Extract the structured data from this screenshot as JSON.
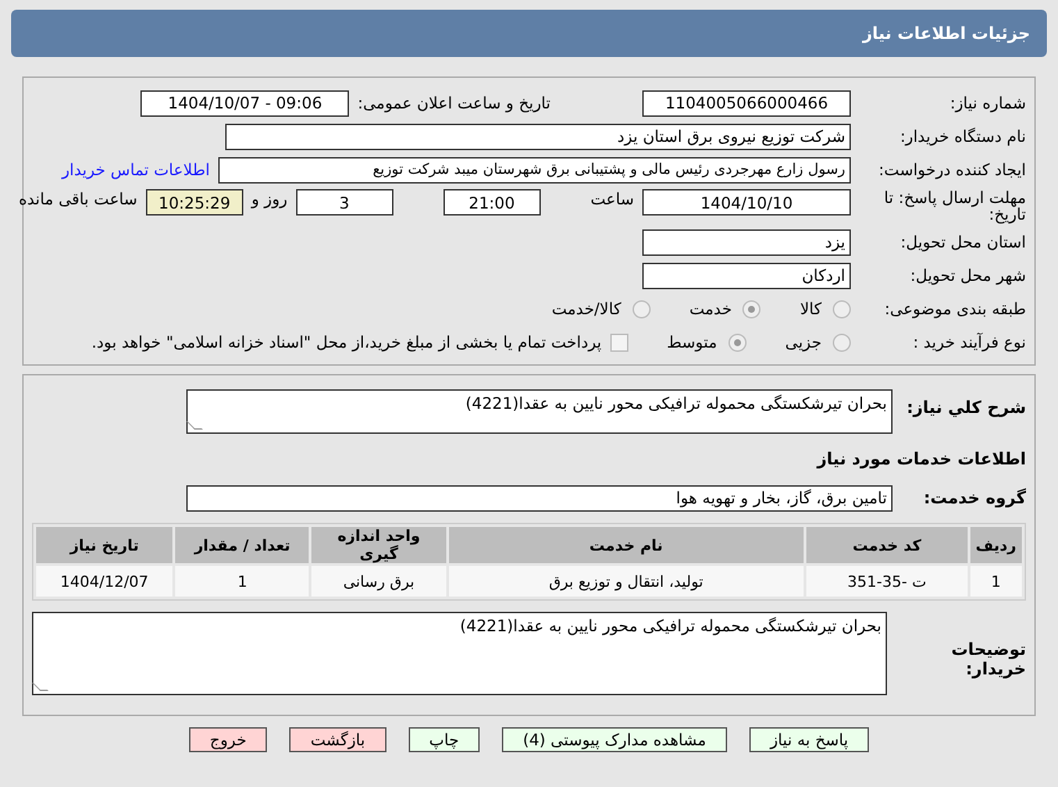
{
  "header": {
    "title": "جزئیات اطلاعات نیاز"
  },
  "need_number": {
    "label": "شماره نیاز:",
    "value": "1104005066000466"
  },
  "announce_date": {
    "label": "تاریخ و ساعت اعلان عمومی:",
    "value": "1404/10/07 - 09:06"
  },
  "buyer_org": {
    "label": "نام دستگاه خریدار:",
    "value": "شرکت توزیع نیروی برق استان یزد"
  },
  "requester": {
    "label": "ایجاد کننده درخواست:",
    "value": "رسول  زارع مهرجردی  رئیس مالی و پشتیبانی برق شهرستان میبد شرکت توزیع",
    "link": "اطلاعات تماس خریدار"
  },
  "deadline": {
    "label": "مهلت ارسال پاسخ: تا تاریخ:",
    "date": "1404/10/10",
    "time_label": "ساعت",
    "time": "21:00",
    "days": "3",
    "days_label": "روز و",
    "remaining": "10:25:29",
    "remaining_label": "ساعت باقی مانده"
  },
  "province": {
    "label": "استان محل تحویل:",
    "value": "یزد"
  },
  "city": {
    "label": "شهر محل تحویل:",
    "value": "اردکان"
  },
  "classification": {
    "label": "طبقه بندی موضوعی:",
    "options": [
      {
        "label": "کالا",
        "selected": false
      },
      {
        "label": "خدمت",
        "selected": true
      },
      {
        "label": "کالا/خدمت",
        "selected": false
      }
    ]
  },
  "purchase_type": {
    "label": "نوع فرآیند خرید :",
    "options": [
      {
        "label": "جزیی",
        "selected": false
      },
      {
        "label": "متوسط",
        "selected": true
      }
    ],
    "treasury": {
      "checked": false,
      "label": "پرداخت تمام یا بخشی از مبلغ خرید،از محل \"اسناد خزانه اسلامی\" خواهد بود."
    }
  },
  "description": {
    "label": "شرح کلي نياز:",
    "value": "بحران تیرشکستگی محموله ترافیکی محور نایین به عقدا(4221)"
  },
  "services_heading": "اطلاعات خدمات مورد نیاز",
  "service_group": {
    "label": "گروه خدمت:",
    "value": "تامین برق، گاز، بخار و تهویه هوا"
  },
  "table": {
    "columns": [
      "ردیف",
      "کد خدمت",
      "نام خدمت",
      "واحد اندازه گیری",
      "تعداد / مقدار",
      "تاریخ نیاز"
    ],
    "rows": [
      [
        "1",
        "ت -35-351",
        "تولید، انتقال و توزیع برق",
        "برق رسانی",
        "1",
        "1404/12/07"
      ]
    ]
  },
  "buyer_notes": {
    "label": "توضیحات خریدار:",
    "value": "بحران تیرشکستگی محموله ترافیکی محور نایین به عقدا(4221)"
  },
  "buttons": [
    {
      "label": "پاسخ به نیاز",
      "kind": "primary"
    },
    {
      "label": "مشاهده مدارک پیوستی (4)",
      "kind": "primary"
    },
    {
      "label": "چاپ",
      "kind": "primary"
    },
    {
      "label": "بازگشت",
      "kind": "danger"
    },
    {
      "label": "خروج",
      "kind": "danger"
    }
  ]
}
